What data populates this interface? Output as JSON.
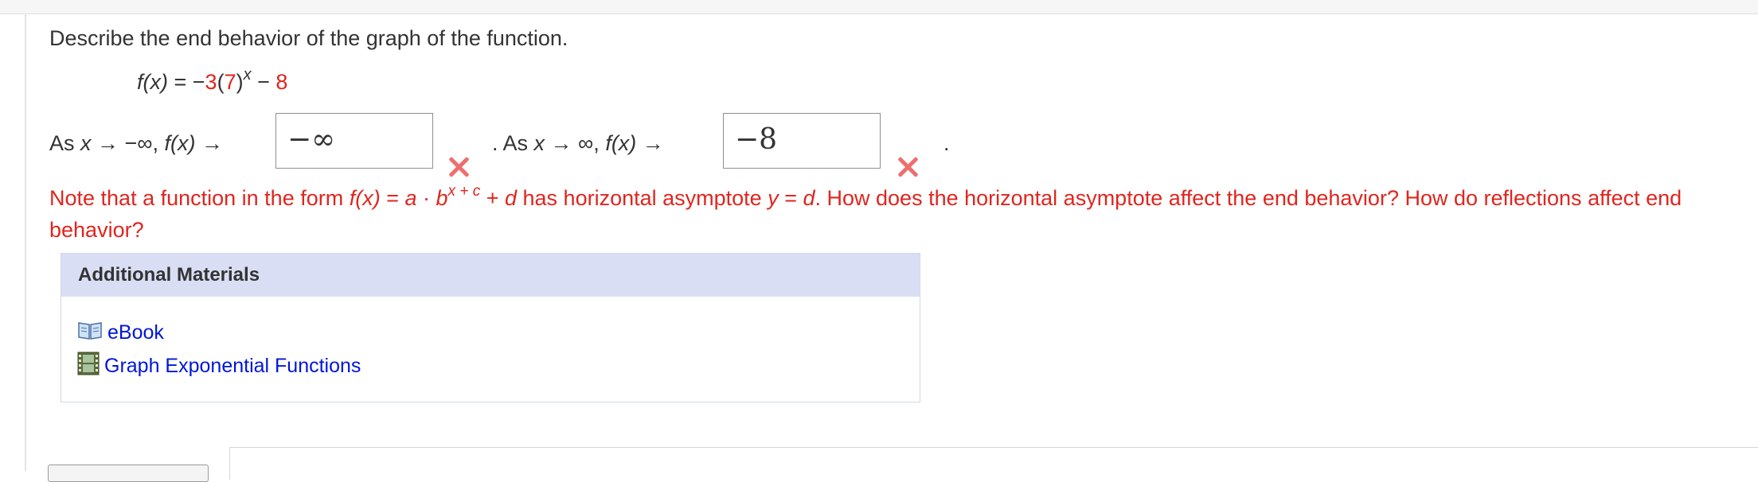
{
  "question": {
    "prompt": "Describe the end behavior of the graph of the function."
  },
  "equation": {
    "lhs": "f(x)",
    "eq": " = −",
    "coef": "3",
    "paren_open": "(",
    "base": "7",
    "paren_close": ")",
    "exponent": "x",
    "minus": " − ",
    "constant": "8"
  },
  "end_behavior": {
    "left": {
      "as": "As ",
      "x": "x",
      "arrow": " → −∞, ",
      "fx": "f(x)",
      "arrow2": " →",
      "answer": "−∞"
    },
    "right": {
      "period": ".",
      "as": " As ",
      "x": "x",
      "arrow": " → ∞, ",
      "fx": "f(x)",
      "arrow2": " →",
      "answer": "−8"
    },
    "end_period": "."
  },
  "note": {
    "p1": "Note that a function in the form  ",
    "fx": "f(x)",
    "p2": " = ",
    "a": "a",
    "p3": " · ",
    "b": "b",
    "sup": "x + c",
    "p4": " + ",
    "d": "d",
    "p5": "  has horizontal asymptote  ",
    "y": "y",
    "p6": " = ",
    "d2": "d",
    "p7": ".  How does the horizontal asymptote affect the end behavior? How do reflections affect end behavior?"
  },
  "materials": {
    "header": "Additional Materials",
    "links": [
      {
        "label": "eBook",
        "icon": "book-icon"
      },
      {
        "label": "Graph Exponential Functions",
        "icon": "film-icon"
      }
    ]
  },
  "colors": {
    "error_red": "#e0251f",
    "x_mark": "#ee6e6e",
    "link_blue": "#0016d9",
    "header_bg": "#d9def5"
  }
}
